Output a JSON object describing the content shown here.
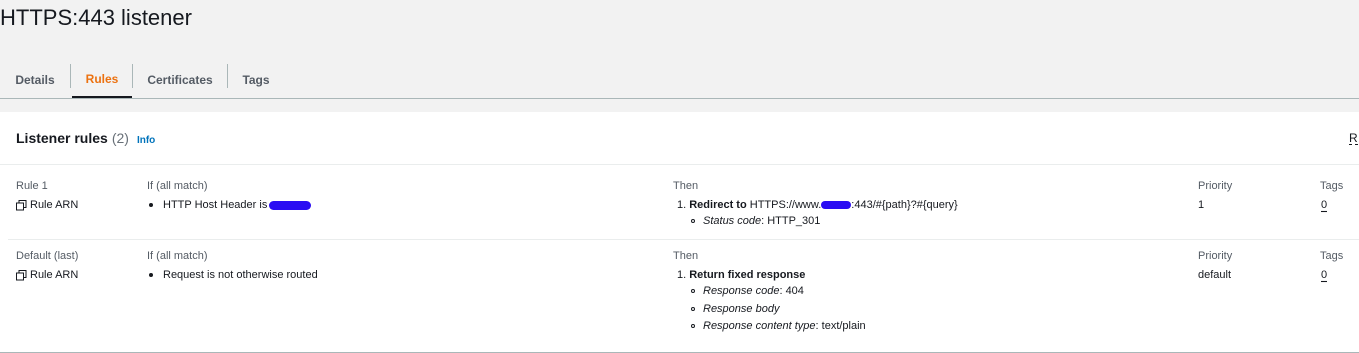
{
  "page_title": "HTTPS:443 listener",
  "tabs": [
    {
      "label": "Details",
      "active": false
    },
    {
      "label": "Rules",
      "active": true
    },
    {
      "label": "Certificates",
      "active": false
    },
    {
      "label": "Tags",
      "active": false
    }
  ],
  "accent_color": "#ec7211",
  "card": {
    "title": "Listener rules",
    "count": "(2)",
    "info": "Info",
    "header_right_partial": "R"
  },
  "columns": {
    "if": "If (all match)",
    "then": "Then",
    "priority": "Priority",
    "tags": "Tags"
  },
  "rules": [
    {
      "name": "Rule 1",
      "arn_label": "Rule ARN",
      "condition": "HTTP Host Header is",
      "then_action": "Redirect to",
      "then_target_prefix": "HTTPS://www.",
      "then_target_suffix": ":443/#{path}?#{query}",
      "details": [
        {
          "key": "Status code",
          "value": ": HTTP_301"
        }
      ],
      "priority": "1",
      "tags": "0"
    },
    {
      "name": "Default (last)",
      "arn_label": "Rule ARN",
      "condition": "Request is not otherwise routed",
      "then_action": "Return fixed response",
      "details": [
        {
          "key": "Response code",
          "value": ": 404"
        },
        {
          "key": "Response body",
          "value": ""
        },
        {
          "key": "Response content type",
          "value": ": text/plain"
        }
      ],
      "priority": "default",
      "tags": "0"
    }
  ]
}
